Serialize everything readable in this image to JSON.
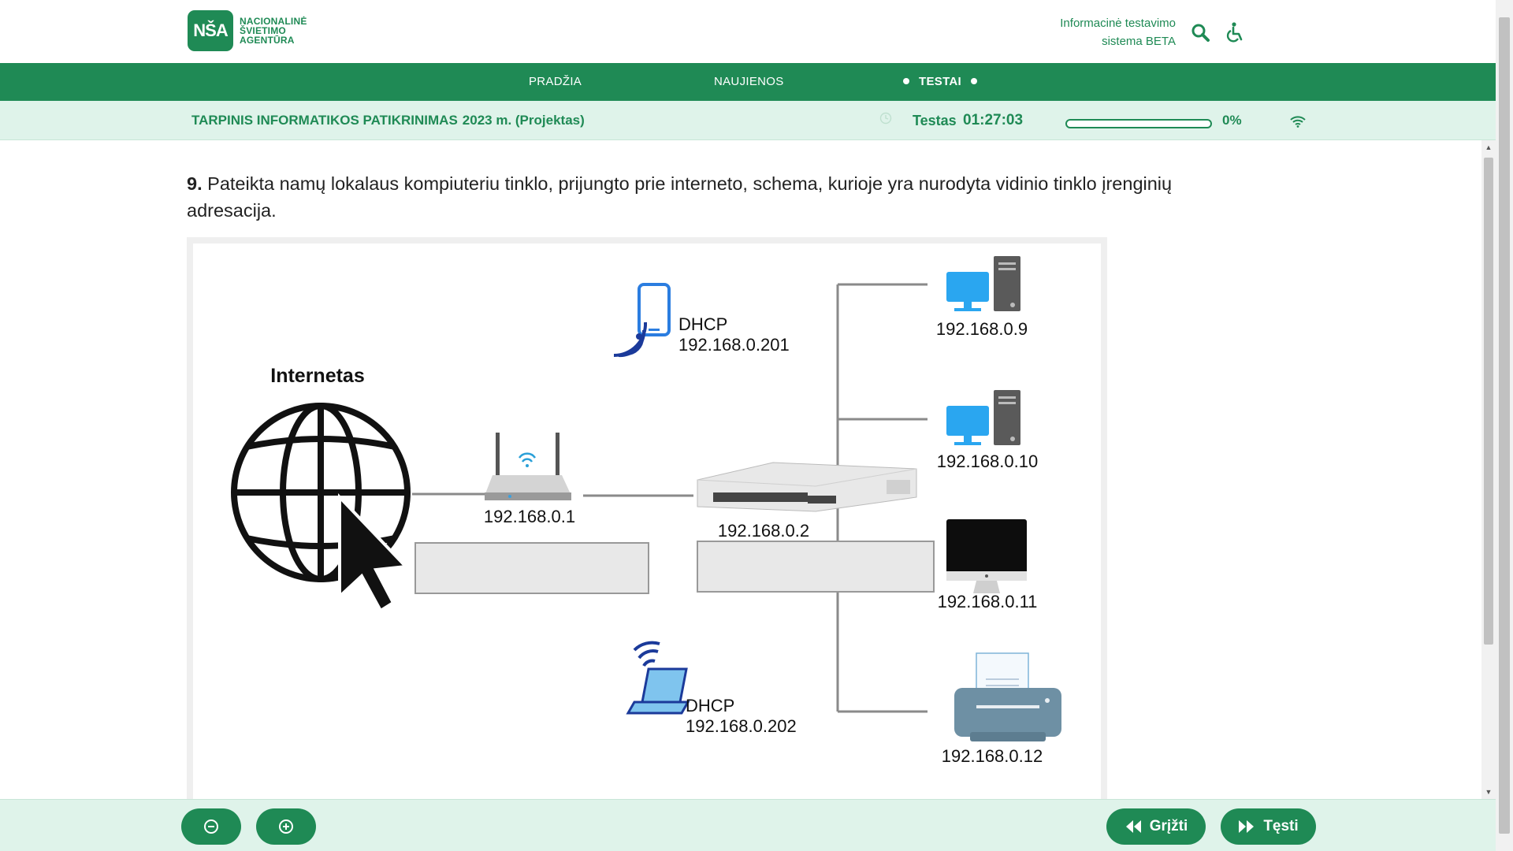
{
  "header": {
    "logo_mark": "NŠA",
    "logo_lines": [
      "NACIONALINĖ",
      "ŠVIETIMO",
      "AGENTŪRA"
    ],
    "system_title_line1": "Informacinė testavimo",
    "system_title_line2": "sistema BETA",
    "icons": [
      "search-icon",
      "accessibility-icon"
    ]
  },
  "nav": {
    "items": [
      {
        "label": "PRADŽIA"
      },
      {
        "label": "NAUJIENOS"
      },
      {
        "label": "TESTAI",
        "active": true
      }
    ]
  },
  "exam_bar": {
    "title": "TARPINIS INFORMATIKOS PATIKRINIMAS",
    "year": "2023 m. (Projektas)",
    "test_label": "Testas",
    "timer": "01:27:03",
    "progress_percent": 0,
    "progress_label": "0%"
  },
  "question": {
    "number": "9.",
    "text": "Pateikta namų lokalaus kompiuteriu tinklo, prijungto prie interneto, schema, kurioje yra nurodyta vidinio tinklo įrenginių adresacija."
  },
  "diagram": {
    "internet_label": "Internetas",
    "router_ip": "192.168.0.1",
    "switch_ip": "192.168.0.2",
    "phone_dhcp": "DHCP",
    "phone_ip": "192.168.0.201",
    "laptop_dhcp": "DHCP",
    "laptop_ip": "192.168.0.202",
    "pc1_ip": "192.168.0.9",
    "pc2_ip": "192.168.0.10",
    "imac_ip": "192.168.0.11",
    "printer_ip": "192.168.0.12"
  },
  "footer": {
    "back_label": "Grįžti",
    "next_label": "Tęsti"
  },
  "colors": {
    "brand_green": "#1f8a55",
    "light_green": "#dff3ea"
  }
}
